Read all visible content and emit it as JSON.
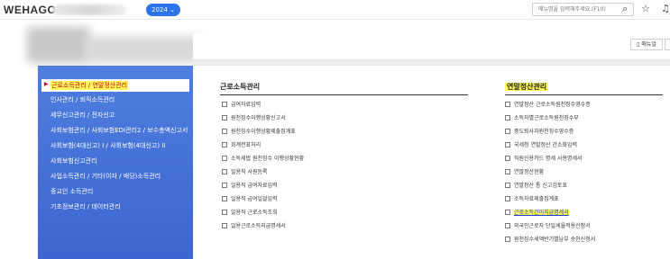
{
  "header": {
    "logo": "WEHAGO",
    "year_badge": "2024 ⌄",
    "search_placeholder": "메뉴명을 입력해주세요.(F10)",
    "icons": [
      "search-icon",
      "star-icon",
      "bell-icon"
    ]
  },
  "toolbar": {
    "manual_label": "매뉴얼"
  },
  "sidebar": {
    "active": "근로소득관리 / 연말정산관리",
    "items": [
      "인사관리 / 퇴직소득관리",
      "세무신고관리 / 전자신고",
      "사회보험관리 / 사회보험EDI관리2 / 보수총액신고서",
      "사회보험(4대신고) I / 사회보험(4대신고) II",
      "사회보험신고관리",
      "사업소득관리 / 기타(이자 / 배당)소득관리",
      "종교인 소득관리",
      "기초정보관리 / 데이터관리"
    ]
  },
  "sections": {
    "income": {
      "title": "근로소득관리",
      "links": [
        "급여자료입력",
        "원천징수이행상황신고서",
        "원천징수이행상황제출집계표",
        "회계전표처리",
        "소득세법 원천징수 이행상황현황",
        "일용직 사원등록",
        "일용직 급여자료입력",
        "일용직 급여일괄입력",
        "일용직 근로소득조회",
        "일용근로소득지급명세서"
      ]
    },
    "yearend": {
      "title": "연말정산관리",
      "links": [
        "연말정산 근로소득원천징수영수증",
        "소득자별근로소득원천징수부",
        "중도퇴사자원천징수영수증",
        "국세청 연말정산 간소화입력",
        "직원신용카드 명세 사용명세서",
        "연말정산현황",
        "연말정산 통 신고검토표",
        "소득자료제출집계표",
        "근로소득간이지급명세서",
        "외국인근로자 단일세율적용신청서",
        "원천징수세액반기별납부 승인신청서"
      ]
    }
  },
  "colors": {
    "sidebar_blue": "#4479db",
    "highlight": "#fff95a",
    "active_text": "#d0021b",
    "link_highlight": "#1b3fd1"
  }
}
